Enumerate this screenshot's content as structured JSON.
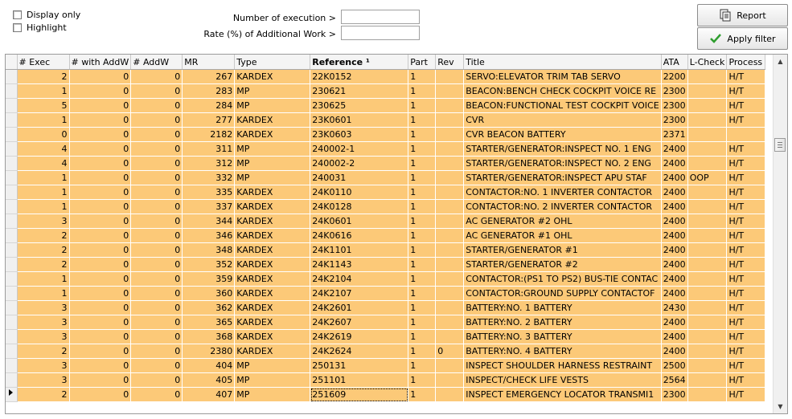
{
  "filters": {
    "display_only": "Display only",
    "highlight": "Highlight",
    "exec_label": "Number of execution >",
    "exec_value": "",
    "rate_label": "Rate (%) of Additional Work >",
    "rate_value": ""
  },
  "buttons": {
    "report": "Report",
    "apply_filter": "Apply filter"
  },
  "grid": {
    "columns": [
      "# Exec",
      "# with AddW",
      "# AddW",
      "MR",
      "Type",
      "Reference ¹",
      "Part",
      "Rev",
      "Title",
      "ATA",
      "L-Check",
      "Process"
    ],
    "rows": [
      [
        "2",
        "0",
        "0",
        "267",
        "KARDEX",
        "22K0152",
        "1",
        "",
        "SERVO:ELEVATOR TRIM TAB SERVO",
        "2200",
        "",
        "H/T"
      ],
      [
        "1",
        "0",
        "0",
        "283",
        "MP",
        "230621",
        "1",
        "",
        "BEACON:BENCH CHECK  COCKPIT VOICE RE",
        "2300",
        "",
        "H/T"
      ],
      [
        "5",
        "0",
        "0",
        "284",
        "MP",
        "230625",
        "1",
        "",
        "BEACON:FUNCTIONAL TEST  COCKPIT VOICE",
        "2300",
        "",
        "H/T"
      ],
      [
        "1",
        "0",
        "0",
        "277",
        "KARDEX",
        "23K0601",
        "1",
        "",
        "CVR",
        "2300",
        "",
        "H/T"
      ],
      [
        "0",
        "0",
        "0",
        "2182",
        "KARDEX",
        "23K0603",
        "1",
        "",
        "CVR BEACON BATTERY",
        "2371",
        "",
        ""
      ],
      [
        "4",
        "0",
        "0",
        "311",
        "MP",
        "240002-1",
        "1",
        "",
        "STARTER/GENERATOR:INSPECT NO. 1 ENG",
        "2400",
        "",
        "H/T"
      ],
      [
        "4",
        "0",
        "0",
        "312",
        "MP",
        "240002-2",
        "1",
        "",
        "STARTER/GENERATOR:INSPECT NO. 2 ENG",
        "2400",
        "",
        "H/T"
      ],
      [
        "1",
        "0",
        "0",
        "332",
        "MP",
        "240031",
        "1",
        "",
        "STARTER/GENERATOR:INSPECT  APU STAF",
        "2400",
        "OOP",
        "H/T"
      ],
      [
        "1",
        "0",
        "0",
        "335",
        "KARDEX",
        "24K0110",
        "1",
        "",
        "CONTACTOR:NO. 1 INVERTER CONTACTOR",
        "2400",
        "",
        "H/T"
      ],
      [
        "1",
        "0",
        "0",
        "337",
        "KARDEX",
        "24K0128",
        "1",
        "",
        "CONTACTOR:NO. 2 INVERTER CONTACTOR",
        "2400",
        "",
        "H/T"
      ],
      [
        "3",
        "0",
        "0",
        "344",
        "KARDEX",
        "24K0601",
        "1",
        "",
        "AC GENERATOR #2 OHL",
        "2400",
        "",
        "H/T"
      ],
      [
        "2",
        "0",
        "0",
        "346",
        "KARDEX",
        "24K0616",
        "1",
        "",
        "AC GENERATOR #1 OHL",
        "2400",
        "",
        "H/T"
      ],
      [
        "2",
        "0",
        "0",
        "348",
        "KARDEX",
        "24K1101",
        "1",
        "",
        "STARTER/GENERATOR #1",
        "2400",
        "",
        "H/T"
      ],
      [
        "2",
        "0",
        "0",
        "352",
        "KARDEX",
        "24K1143",
        "1",
        "",
        "STARTER/GENERATOR #2",
        "2400",
        "",
        "H/T"
      ],
      [
        "1",
        "0",
        "0",
        "359",
        "KARDEX",
        "24K2104",
        "1",
        "",
        "CONTACTOR:(PS1 TO PS2) BUS-TIE CONTAC",
        "2400",
        "",
        "H/T"
      ],
      [
        "1",
        "0",
        "0",
        "360",
        "KARDEX",
        "24K2107",
        "1",
        "",
        "CONTACTOR:GROUND SUPPLY CONTACTOF",
        "2400",
        "",
        "H/T"
      ],
      [
        "3",
        "0",
        "0",
        "362",
        "KARDEX",
        "24K2601",
        "1",
        "",
        "BATTERY:NO. 1 BATTERY",
        "2430",
        "",
        "H/T"
      ],
      [
        "3",
        "0",
        "0",
        "365",
        "KARDEX",
        "24K2607",
        "1",
        "",
        "BATTERY:NO. 2 BATTERY",
        "2400",
        "",
        "H/T"
      ],
      [
        "3",
        "0",
        "0",
        "368",
        "KARDEX",
        "24K2619",
        "1",
        "",
        "BATTERY:NO. 3 BATTERY",
        "2400",
        "",
        "H/T"
      ],
      [
        "2",
        "0",
        "0",
        "2380",
        "KARDEX",
        "24K2624",
        "1",
        "0",
        "BATTERY:NO. 4 BATTERY",
        "2400",
        "",
        "H/T"
      ],
      [
        "3",
        "0",
        "0",
        "404",
        "MP",
        "250131",
        "1",
        "",
        "INSPECT  SHOULDER HARNESS RESTRAINT",
        "2500",
        "",
        "H/T"
      ],
      [
        "3",
        "0",
        "0",
        "405",
        "MP",
        "251101",
        "1",
        "",
        "INSPECT/CHECK  LIFE VESTS",
        "2564",
        "",
        "H/T"
      ],
      [
        "2",
        "0",
        "0",
        "407",
        "MP",
        "251609",
        "1",
        "",
        "INSPECT  EMERGENCY LOCATOR TRANSMI1",
        "2300",
        "",
        "H/T"
      ]
    ]
  },
  "colors": {
    "row_highlight": "#fcc978"
  }
}
